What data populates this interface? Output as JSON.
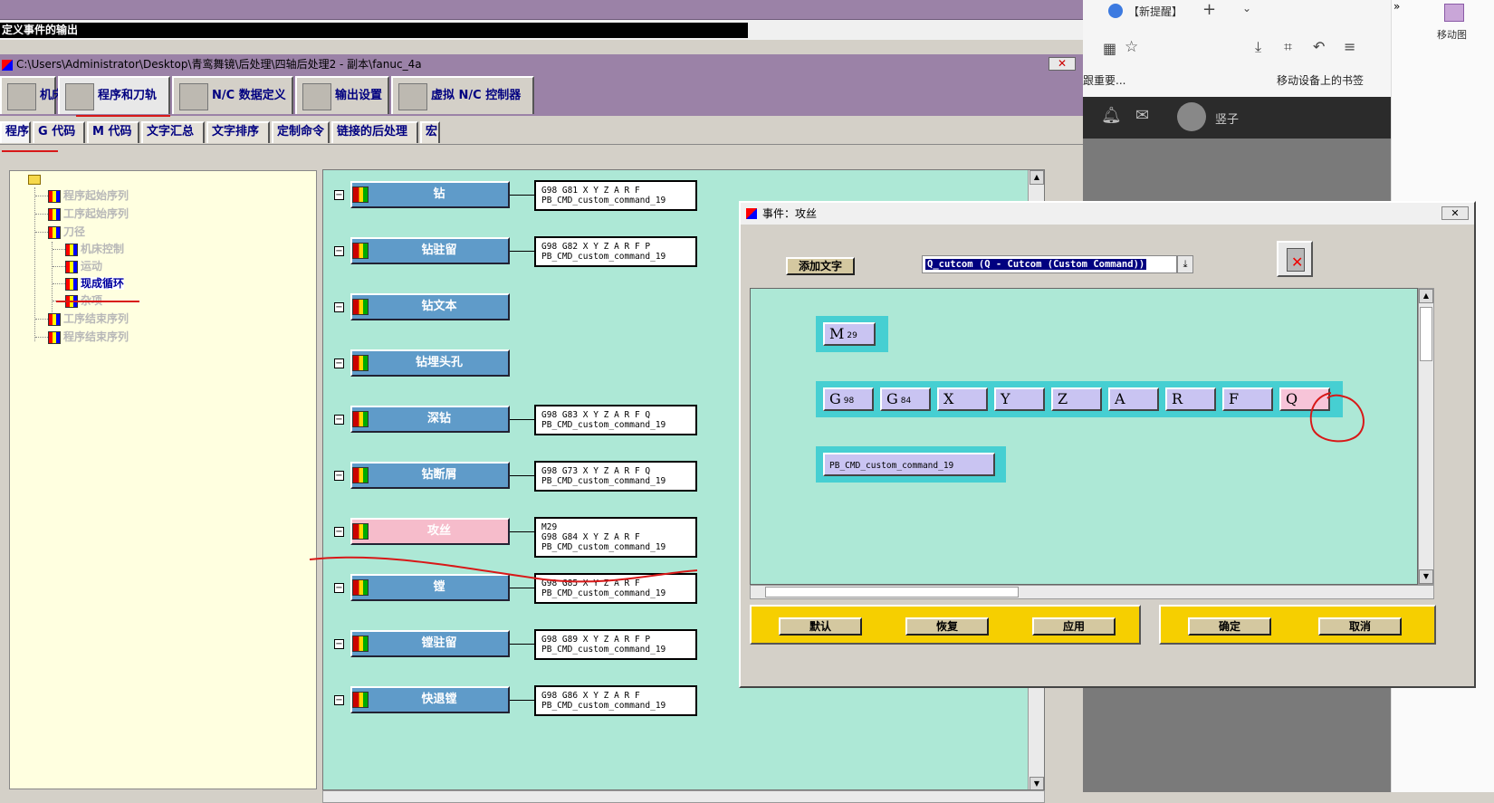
{
  "event_output_label": "定义事件的输出",
  "main_window": {
    "title": "C:\\Users\\Administrator\\Desktop\\青鸾舞镜\\后处理\\四轴后处理2 - 副本\\fanuc_4a",
    "close": "✕",
    "tabs": [
      "机床",
      "程序和刀轨",
      "N/C 数据定义",
      "输出设置",
      "虚拟 N/C 控制器"
    ],
    "sub_tabs": [
      "程序",
      "G 代码",
      "M 代码",
      "文字汇总",
      "文字排序",
      "定制命令",
      "链接的后处理",
      "宏"
    ]
  },
  "tree": {
    "items": [
      {
        "label": "程序起始序列",
        "level": 1
      },
      {
        "label": "工序起始序列",
        "level": 1
      },
      {
        "label": "刀径",
        "level": 1
      },
      {
        "label": "机床控制",
        "level": 2
      },
      {
        "label": "运动",
        "level": 2
      },
      {
        "label": "现成循环",
        "level": 2,
        "selected": true
      },
      {
        "label": "杂项",
        "level": 2
      },
      {
        "label": "工序结束序列",
        "level": 1
      },
      {
        "label": "程序结束序列",
        "level": 1
      }
    ]
  },
  "events": [
    {
      "label": "钻",
      "code": "G98 G81 X Y Z A R F\nPB_CMD_custom_command_19"
    },
    {
      "label": "钻驻留",
      "code": "G98 G82 X Y Z A R F P\nPB_CMD_custom_command_19"
    },
    {
      "label": "钻文本",
      "code": ""
    },
    {
      "label": "钻埋头孔",
      "code": ""
    },
    {
      "label": "深钻",
      "code": "G98 G83 X Y Z A R F Q\nPB_CMD_custom_command_19"
    },
    {
      "label": "钻断屑",
      "code": "G98 G73 X Y Z A R F Q\nPB_CMD_custom_command_19"
    },
    {
      "label": "攻丝",
      "code": "M29\nG98 G84 X Y Z A R F\nPB_CMD_custom_command_19",
      "active": true
    },
    {
      "label": "镗",
      "code": "G98 G85 X Y Z A R F\nPB_CMD_custom_command_19"
    },
    {
      "label": "镗驻留",
      "code": "G98 G89 X Y Z A R F P\nPB_CMD_custom_command_19"
    },
    {
      "label": "快退镗",
      "code": "G98 G86 X Y Z A R F\nPB_CMD_custom_command_19"
    }
  ],
  "browser": {
    "tab_title": "【新提醒】",
    "new_tab": "+",
    "snippet": "跟重要...",
    "mobile_bookmarks": "移动设备上的书签",
    "user_name": "竖子",
    "side_label": "移动图",
    "more": "»"
  },
  "dialog": {
    "title": "事件：攻丝",
    "close": "✕",
    "add_text_label": "添加文字",
    "command_select_value": "Q_cutcom (Q - Cutcom (Custom Command))",
    "blocks": [
      [
        {
          "w": "M",
          "s": "29"
        }
      ],
      [
        {
          "w": "G",
          "s": "98"
        },
        {
          "w": "G",
          "s": "84"
        },
        {
          "w": "X",
          "s": ""
        },
        {
          "w": "Y",
          "s": ""
        },
        {
          "w": "Z",
          "s": ""
        },
        {
          "w": "A",
          "s": ""
        },
        {
          "w": "R",
          "s": ""
        },
        {
          "w": "F",
          "s": ""
        },
        {
          "w": "Q",
          "s": "",
          "highlight": true
        }
      ],
      [
        {
          "w": "PB_CMD_custom_command_19",
          "s": ""
        }
      ]
    ],
    "buttons_left": [
      "默认",
      "恢复",
      "应用"
    ],
    "buttons_right": [
      "确定",
      "取消"
    ]
  },
  "colors": {
    "purple": "#9b82a7",
    "teal_panel": "#ade8d6",
    "event_button": "#5f9bc9",
    "event_active": "#f6bccb",
    "block_bg": "#46cfd2",
    "word_bg": "#c9c4f2",
    "yellow": "#f6cf00"
  }
}
